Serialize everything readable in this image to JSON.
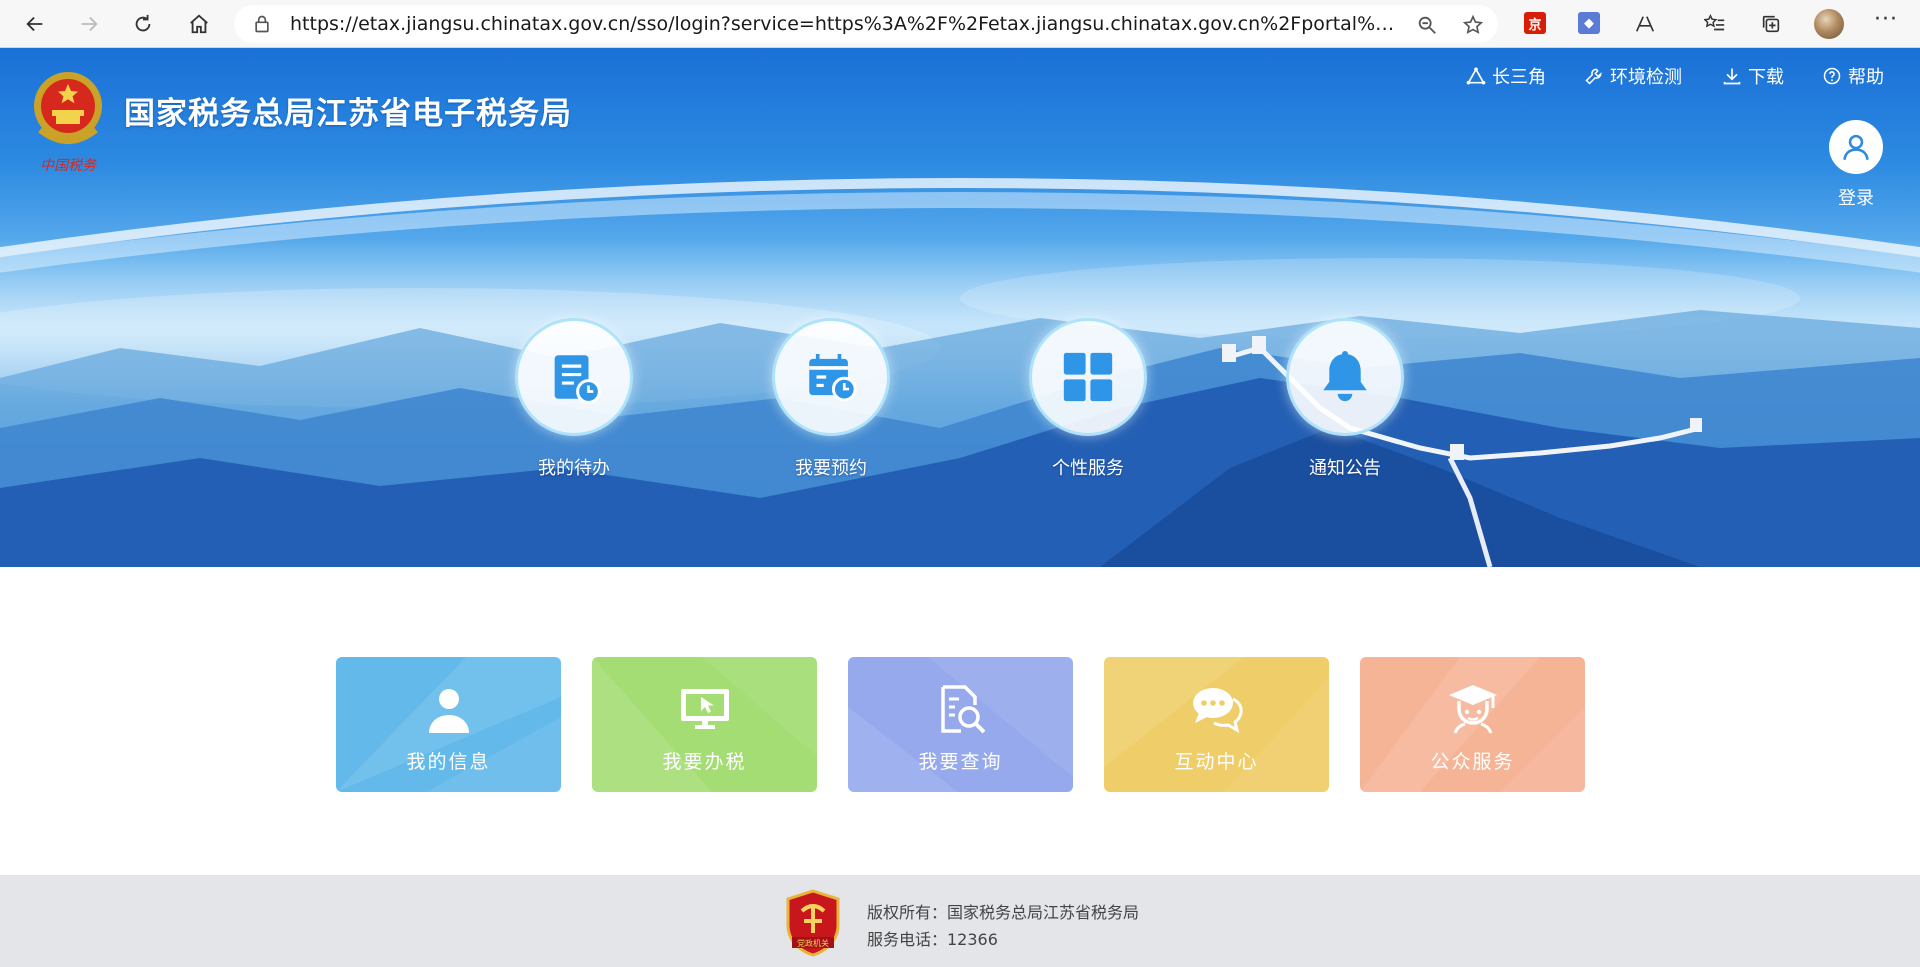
{
  "browser": {
    "url": "https://etax.jiangsu.chinatax.gov.cn/sso/login?service=https%3A%2F%2Fetax.jiangsu.chinatax.gov.cn%2Fportal%2Flogin.do...",
    "extensions": [
      {
        "glyph": "京",
        "color": "#d81e06"
      },
      {
        "glyph": "◆",
        "color": "#5a7bd6"
      }
    ]
  },
  "header": {
    "site_title": "国家税务总局江苏省电子税务局",
    "emblem_caption": "中国税务",
    "nav": [
      {
        "label": "长三角",
        "icon": "triangle-nodes-icon"
      },
      {
        "label": "环境检测",
        "icon": "wrench-icon"
      },
      {
        "label": "下载",
        "icon": "download-icon"
      },
      {
        "label": "帮助",
        "icon": "help-icon"
      }
    ],
    "login_label": "登录"
  },
  "hubs": [
    {
      "label": "我的待办",
      "icon": "todo-list-icon"
    },
    {
      "label": "我要预约",
      "icon": "calendar-clock-icon"
    },
    {
      "label": "个性服务",
      "icon": "grid-icon"
    },
    {
      "label": "通知公告",
      "icon": "bell-icon"
    }
  ],
  "tiles": [
    {
      "label": "我的信息",
      "icon": "user-icon",
      "color": "#63b9ea"
    },
    {
      "label": "我要办税",
      "icon": "monitor-cursor-icon",
      "color": "#a3dd73"
    },
    {
      "label": "我要查询",
      "icon": "document-search-icon",
      "color": "#95a9ec"
    },
    {
      "label": "互动中心",
      "icon": "chat-bubbles-icon",
      "color": "#efcd68"
    },
    {
      "label": "公众服务",
      "icon": "graduate-icon",
      "color": "#f6b497"
    }
  ],
  "footer": {
    "copyright": "版权所有：国家税务总局江苏省税务局",
    "phone": "服务电话：12366",
    "badge_text": "党政机关"
  }
}
